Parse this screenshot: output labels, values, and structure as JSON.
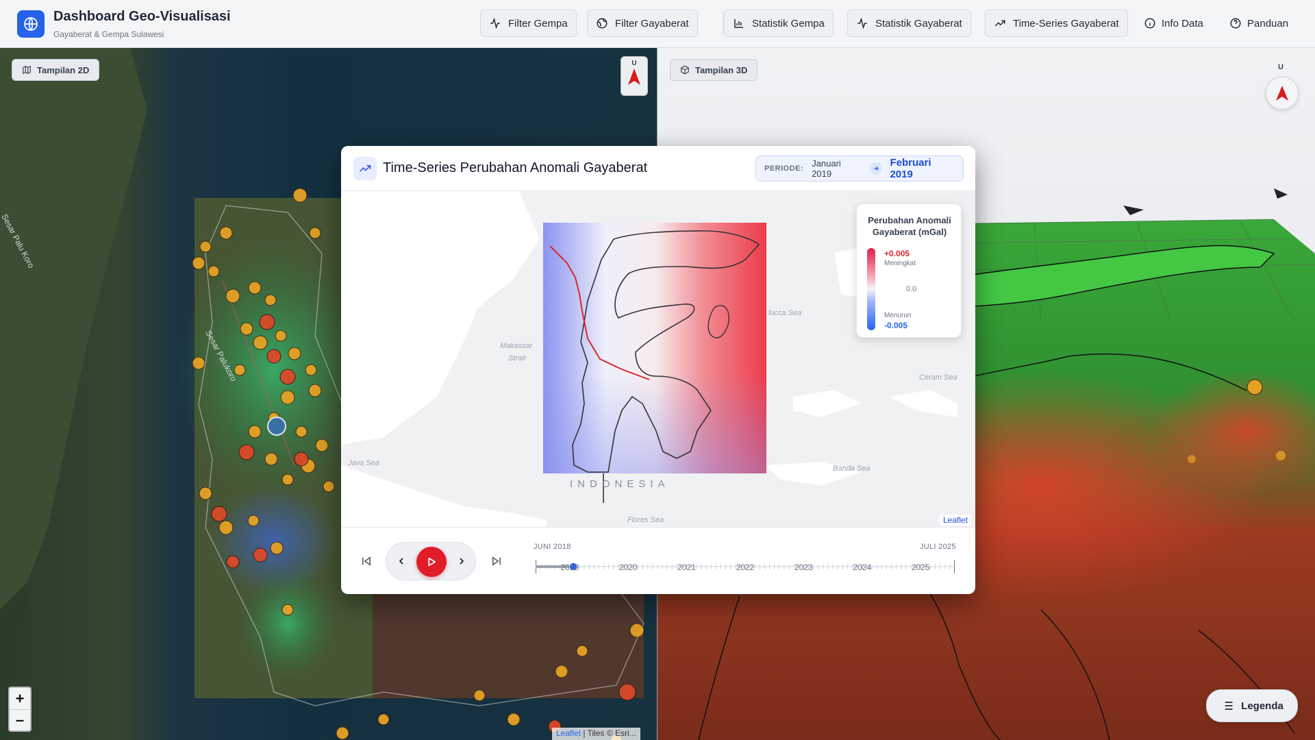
{
  "header": {
    "title": "Dashboard Geo-Visualisasi",
    "subtitle": "Gayaberat & Gempa Sulawesi",
    "nav": {
      "filter_gempa": "Filter Gempa",
      "filter_gayaberat": "Filter Gayaberat",
      "statistik_gempa": "Statistik Gempa",
      "statistik_gayaberat": "Statistik Gayaberat",
      "timeseries": "Time-Series Gayaberat",
      "info": "Info Data",
      "panduan": "Panduan"
    }
  },
  "map2d": {
    "tag": "Tampilan 2D",
    "compass": "U",
    "zoom_in": "+",
    "zoom_out": "–",
    "attribution_link": "Leaflet",
    "attribution_rest": " | Tiles © Esri...",
    "labels": {
      "fault1": "Sesar Palukoro",
      "fault2": "Sesar Palu Koro"
    }
  },
  "map3d": {
    "tag": "Tampilan 3D",
    "compass": "U",
    "legend_button": "Legenda"
  },
  "modal": {
    "title": "Time-Series Perubahan Anomali Gayaberat",
    "periode": {
      "label": "PERIODE:",
      "from": "Januari 2019",
      "to": "Februari 2019"
    },
    "map_labels": {
      "makassar": "Makassar",
      "strait": "Strait",
      "java_sea": "Java Sea",
      "flores_sea": "Flores Sea",
      "banda_sea": "Banda Sea",
      "ceram_sea": "Ceram Sea",
      "molucca_sea": "lucca Sea",
      "indonesia": "INDONESIA"
    },
    "attribution": "Leaflet",
    "legend": {
      "title": "Perubahan Anomali Gayaberat (mGal)",
      "max": "+0.005",
      "max_label": "Meningkat",
      "mid": "0.0",
      "min_label": "Menurun",
      "min": "-0.005",
      "colors": {
        "high": "#e11d48",
        "low": "#2563eb"
      }
    },
    "timeline": {
      "start": "JUNI 2018",
      "end": "JULI 2025",
      "years": [
        "2019",
        "2020",
        "2021",
        "2022",
        "2023",
        "2024",
        "2025"
      ],
      "progress": 0.09,
      "accent": "#2563eb",
      "play_color": "#e11d2a"
    }
  }
}
